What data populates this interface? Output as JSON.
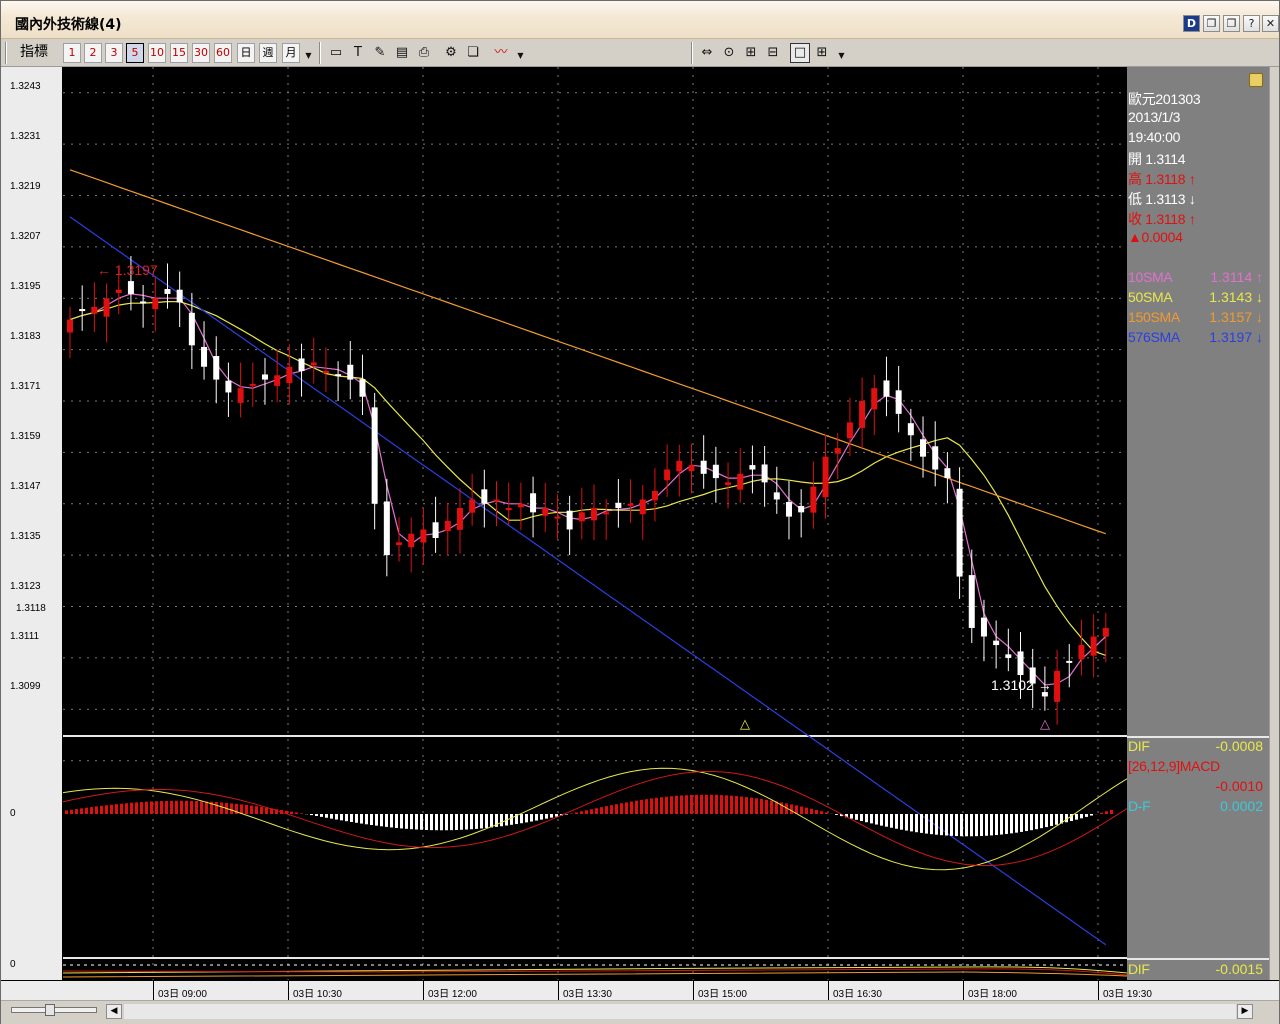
{
  "window": {
    "title": "國內外技術線(4)",
    "controls": [
      "D",
      "❐",
      "❐",
      "?",
      "✕"
    ]
  },
  "toolbar": {
    "label": "指標",
    "periods": [
      "1",
      "2",
      "3",
      "5",
      "10",
      "15",
      "30",
      "60",
      "日",
      "週",
      "月"
    ],
    "selected_period": "5"
  },
  "y_axis_labels": [
    "1.3243",
    "1.3231",
    "1.3219",
    "1.3207",
    "1.3195",
    "1.3183",
    "1.3171",
    "1.3159",
    "1.3147",
    "1.3135",
    "1.3123",
    "1.3118",
    "1.3111",
    "1.3099"
  ],
  "macd_zero": "0",
  "mini_zero": "0",
  "info": {
    "symbol": "歐元201303",
    "date": "2013/1/3",
    "time": "19:40:00",
    "open_label": "開",
    "open": "1.3114",
    "high_label": "高",
    "high": "1.3118",
    "high_arrow": "↑",
    "low_label": "低",
    "low": "1.3113",
    "low_arrow": "↓",
    "close_label": "收",
    "close": "1.3118",
    "close_arrow": "↑",
    "change": "▲0.0004",
    "sma": [
      {
        "name": "10SMA",
        "value": "1.3114",
        "arrow": "↑",
        "color": "#e070d0"
      },
      {
        "name": "50SMA",
        "value": "1.3143",
        "arrow": "↓",
        "color": "#e8e84a"
      },
      {
        "name": "150SMA",
        "value": "1.3157",
        "arrow": "↓",
        "color": "#f09a30"
      },
      {
        "name": "576SMA",
        "value": "1.3197",
        "arrow": "↓",
        "color": "#2b3fe0"
      }
    ],
    "dif_label": "DIF",
    "dif_value": "-0.0008",
    "macd_label": "[26,12,9]MACD",
    "macd_value": "-0.0010",
    "df_label": "D-F",
    "df_value": "0.0002",
    "dif2_label": "DIF",
    "dif2_value": "-0.0015"
  },
  "annotations": {
    "high_mark": "← 1.3197",
    "low_mark": "1.3102 →"
  },
  "x_axis_labels": [
    "03日 09:00",
    "03日 10:30",
    "03日 12:00",
    "03日 13:30",
    "03日 15:00",
    "03日 16:30",
    "03日 18:00",
    "03日 19:30"
  ],
  "colors": {
    "up": "#e01010",
    "down": "#ffffff",
    "sma10": "#e070d0",
    "sma50": "#e8e84a",
    "sma150": "#f09a30",
    "sma576": "#2b3fe0"
  },
  "chart_data": {
    "type": "candlestick",
    "title": "",
    "price_range": [
      1.3093,
      1.3249
    ],
    "closing_prices_approx": [
      1.319,
      1.3192,
      1.3193,
      1.3195,
      1.3197,
      1.3196,
      1.3194,
      1.3195,
      1.3196,
      1.3194,
      1.3184,
      1.3179,
      1.3176,
      1.3173,
      1.3174,
      1.3175,
      1.3176,
      1.3177,
      1.3179,
      1.3178,
      1.318,
      1.3178,
      1.3177,
      1.3176,
      1.3172,
      1.3147,
      1.3135,
      1.3138,
      1.314,
      1.3141,
      1.3139,
      1.3143,
      1.3146,
      1.3148,
      1.3147,
      1.3148,
      1.3146,
      1.3147,
      1.3145,
      1.3146,
      1.3144,
      1.3141,
      1.3145,
      1.3146,
      1.3145,
      1.3146,
      1.3147,
      1.3148,
      1.315,
      1.3155,
      1.3157,
      1.3156,
      1.3154,
      1.3153,
      1.3152,
      1.3154,
      1.3155,
      1.3152,
      1.3148,
      1.3144,
      1.3145,
      1.3151,
      1.3158,
      1.316,
      1.3166,
      1.3171,
      1.3174,
      1.3172,
      1.3168,
      1.3163,
      1.3158,
      1.3155,
      1.3153,
      1.313,
      1.3118,
      1.3116,
      1.3114,
      1.3111,
      1.3107,
      1.3105,
      1.3102,
      1.3108,
      1.311,
      1.3114,
      1.3116,
      1.3118
    ]
  }
}
